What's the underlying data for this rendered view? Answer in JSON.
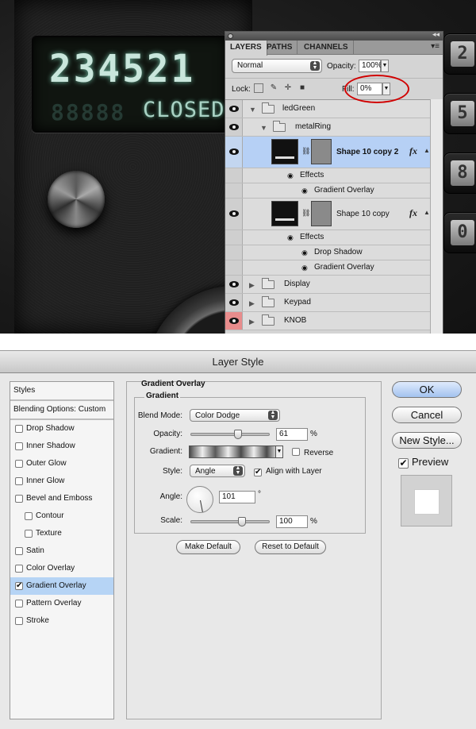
{
  "canvas": {
    "lcd_digits": "234521",
    "lcd_ghost": "88888",
    "lcd_status": "CLOSED",
    "keypad_digits": [
      "2",
      "5",
      "8",
      "0"
    ]
  },
  "layers_panel": {
    "tabs": [
      "LAYERS",
      "PATHS",
      "CHANNELS"
    ],
    "blend_mode": "Normal",
    "opacity_label": "Opacity:",
    "opacity_value": "100%",
    "lock_label": "Lock:",
    "fill_label": "Fill:",
    "fill_value": "0%",
    "highlight_color": "#d10000",
    "selected_color": "#b6d0f5",
    "layers": [
      {
        "name": "ledGreen"
      },
      {
        "name": "metalRing"
      },
      {
        "name": "Shape 10 copy 2"
      },
      {
        "name": "Effects"
      },
      {
        "name": "Gradient Overlay"
      },
      {
        "name": "Shape 10 copy"
      },
      {
        "name": "Effects"
      },
      {
        "name": "Drop Shadow"
      },
      {
        "name": "Gradient Overlay"
      },
      {
        "name": "Display"
      },
      {
        "name": "Keypad"
      },
      {
        "name": "KNOB"
      }
    ]
  },
  "dialog": {
    "title": "Layer Style",
    "styles": [
      {
        "label": "Styles",
        "checked": false
      },
      {
        "label": "Blending Options: Custom",
        "checked": false
      },
      {
        "label": "Drop Shadow",
        "checked": false
      },
      {
        "label": "Inner Shadow",
        "checked": false
      },
      {
        "label": "Outer Glow",
        "checked": false
      },
      {
        "label": "Inner Glow",
        "checked": false
      },
      {
        "label": "Bevel and Emboss",
        "checked": false
      },
      {
        "label": "Contour",
        "checked": false
      },
      {
        "label": "Texture",
        "checked": false
      },
      {
        "label": "Satin",
        "checked": false
      },
      {
        "label": "Color Overlay",
        "checked": false
      },
      {
        "label": "Gradient Overlay",
        "checked": true
      },
      {
        "label": "Pattern Overlay",
        "checked": false
      },
      {
        "label": "Stroke",
        "checked": false
      }
    ],
    "group_title": "Gradient Overlay",
    "subgroup_title": "Gradient",
    "blend_mode_label": "Blend Mode:",
    "blend_mode": "Color Dodge",
    "opacity_label": "Opacity:",
    "opacity_value": "61",
    "opacity_fraction": 0.61,
    "percent": "%",
    "gradient_label": "Gradient:",
    "reverse_label": "Reverse",
    "style_label": "Style:",
    "style_value": "Angle",
    "align_label": "Align with Layer",
    "angle_label": "Angle:",
    "angle_value": "101",
    "degree": "°",
    "scale_label": "Scale:",
    "scale_value": "100",
    "scale_fraction": 0.67,
    "make_default": "Make Default",
    "reset_default": "Reset to Default",
    "ok": "OK",
    "cancel": "Cancel",
    "new_style": "New Style...",
    "preview": "Preview"
  }
}
